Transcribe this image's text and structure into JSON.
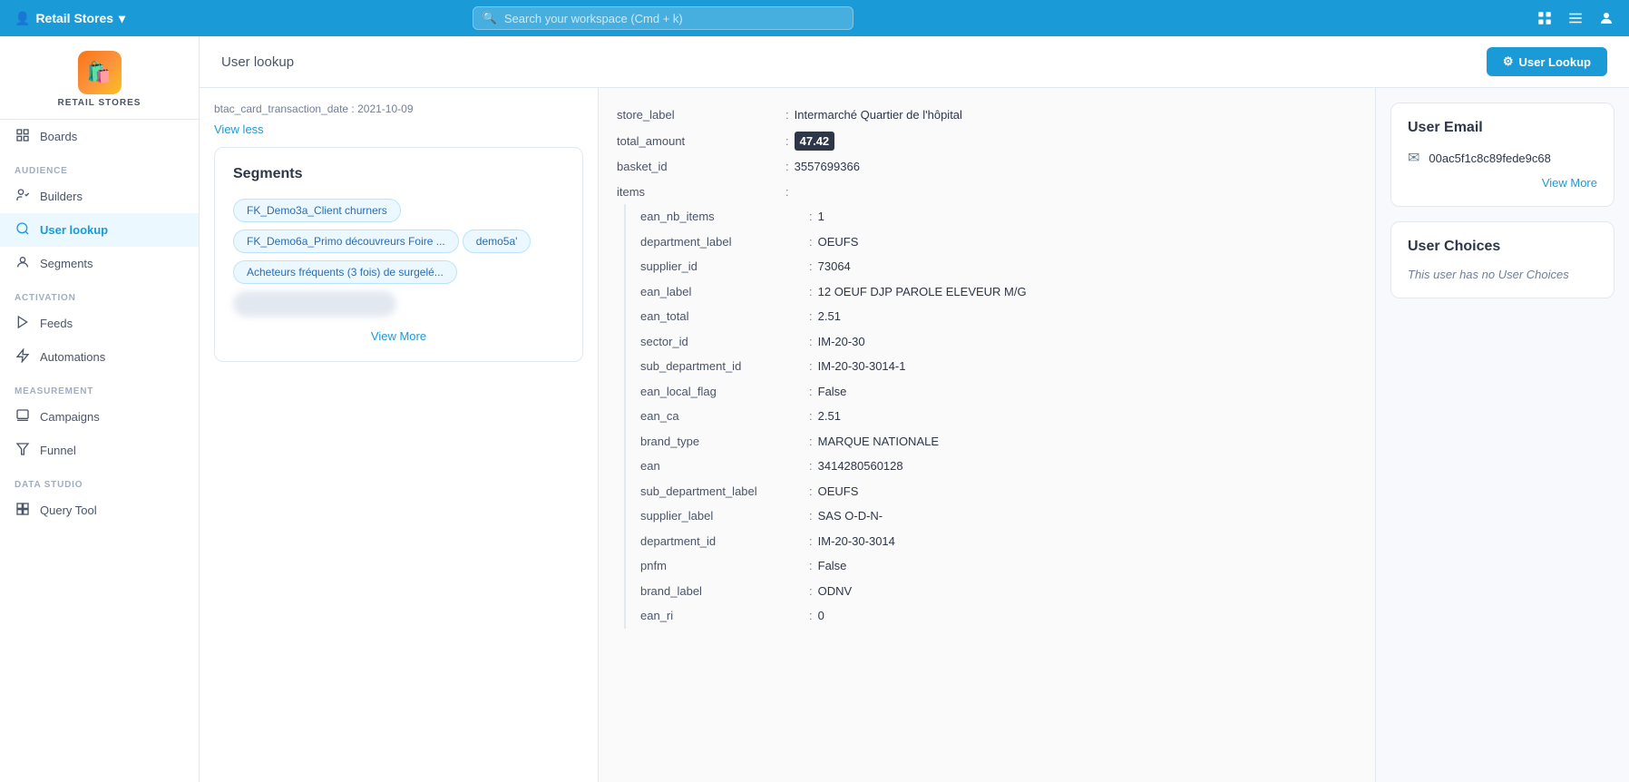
{
  "topNav": {
    "brand": "Retail Stores",
    "searchPlaceholder": "Search your workspace (Cmd + k)",
    "chevron": "▾"
  },
  "pageHeader": {
    "title": "User lookup",
    "buttonLabel": "User Lookup",
    "buttonIcon": "⚙"
  },
  "sidebar": {
    "logoText": "RETAIL STORES",
    "logoEmoji": "🛍",
    "sections": [
      {
        "label": "",
        "items": [
          {
            "id": "boards",
            "label": "Boards",
            "icon": "📊",
            "active": false
          }
        ]
      },
      {
        "label": "AUDIENCE",
        "items": [
          {
            "id": "builders",
            "label": "Builders",
            "icon": "👥",
            "active": false
          },
          {
            "id": "user-lookup",
            "label": "User lookup",
            "icon": "🔍",
            "active": true
          },
          {
            "id": "segments",
            "label": "Segments",
            "icon": "👤",
            "active": false
          }
        ]
      },
      {
        "label": "ACTIVATION",
        "items": [
          {
            "id": "feeds",
            "label": "Feeds",
            "icon": "▶",
            "active": false
          },
          {
            "id": "automations",
            "label": "Automations",
            "icon": "⚡",
            "active": false
          }
        ]
      },
      {
        "label": "MEASUREMENT",
        "items": [
          {
            "id": "campaigns",
            "label": "Campaigns",
            "icon": "📢",
            "active": false
          },
          {
            "id": "funnel",
            "label": "Funnel",
            "icon": "🔽",
            "active": false
          }
        ]
      },
      {
        "label": "DATA STUDIO",
        "items": [
          {
            "id": "query-tool",
            "label": "Query Tool",
            "icon": "⊞",
            "active": false
          }
        ]
      }
    ]
  },
  "leftPanel": {
    "truncatedText": "btac_card_transaction_date : 2021-10-09",
    "viewLessLabel": "View less",
    "segmentsCard": {
      "title": "Segments",
      "tags": [
        "FK_Demo3a_Client churners",
        "FK_Demo6a_Primo découvreurs Foire ...",
        "demo5a'",
        "Acheteurs fréquents (3 fois) de surgelé..."
      ],
      "viewMoreLabel": "View More"
    }
  },
  "middlePanel": {
    "topData": [
      {
        "key": "store_label",
        "sep": ":",
        "val": "Intermarché Quartier de l'hôpital",
        "highlight": false
      },
      {
        "key": "total_amount",
        "sep": ":",
        "val": "47.42",
        "highlight": true
      },
      {
        "key": "basket_id",
        "sep": ":",
        "val": "3557699366",
        "highlight": false
      }
    ],
    "itemsLabel": "items",
    "itemsSep": ":",
    "items": [
      {
        "key": "ean_nb_items",
        "sep": ":",
        "val": "1",
        "highlight": false
      },
      {
        "key": "department_label",
        "sep": ":",
        "val": "OEUFS",
        "highlight": false
      },
      {
        "key": "supplier_id",
        "sep": ":",
        "val": "73064",
        "highlight": false
      },
      {
        "key": "ean_label",
        "sep": ":",
        "val": "12 OEUF DJP PAROLE ELEVEUR M/G",
        "highlight": false
      },
      {
        "key": "ean_total",
        "sep": ":",
        "val": "2.51",
        "highlight": false
      },
      {
        "key": "sector_id",
        "sep": ":",
        "val": "IM-20-30",
        "highlight": false
      },
      {
        "key": "sub_department_id",
        "sep": ":",
        "val": "IM-20-30-3014-1",
        "highlight": false
      },
      {
        "key": "ean_local_flag",
        "sep": ":",
        "val": "False",
        "highlight": false
      },
      {
        "key": "ean_ca",
        "sep": ":",
        "val": "2.51",
        "highlight": false
      },
      {
        "key": "brand_type",
        "sep": ":",
        "val": "MARQUE NATIONALE",
        "highlight": false
      },
      {
        "key": "ean",
        "sep": ":",
        "val": "3414280560128",
        "highlight": false
      },
      {
        "key": "sub_department_label",
        "sep": ":",
        "val": "OEUFS",
        "highlight": false
      },
      {
        "key": "supplier_label",
        "sep": ":",
        "val": "SAS O-D-N-",
        "highlight": false
      },
      {
        "key": "department_id",
        "sep": ":",
        "val": "IM-20-30-3014",
        "highlight": false
      },
      {
        "key": "pnfm",
        "sep": ":",
        "val": "False",
        "highlight": false
      },
      {
        "key": "brand_label",
        "sep": ":",
        "val": "ODNV",
        "highlight": false
      },
      {
        "key": "ean_ri",
        "sep": ":",
        "val": "0",
        "highlight": false
      }
    ]
  },
  "rightPanel": {
    "emailCard": {
      "title": "User Email",
      "emailValue": "00ac5f1c8c89fede9c68",
      "viewMoreLabel": "View More"
    },
    "choicesCard": {
      "title": "User Choices",
      "noChoicesText": "This user has no User Choices"
    }
  }
}
